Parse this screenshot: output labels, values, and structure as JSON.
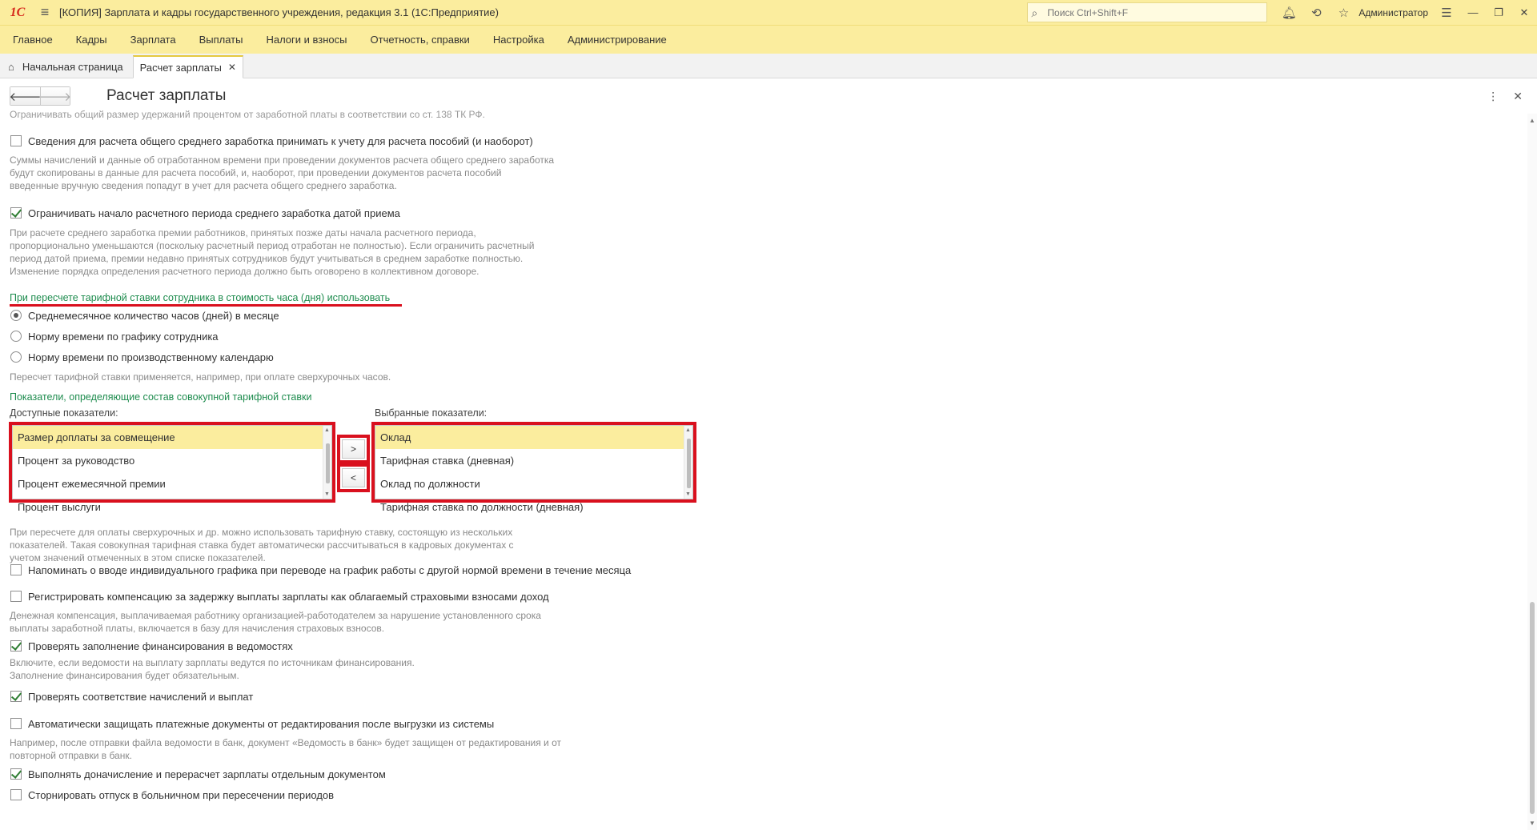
{
  "titlebar": {
    "logo": "1С",
    "title": "[КОПИЯ] Зарплата и кадры государственного учреждения, редакция 3.1  (1С:Предприятие)",
    "search_placeholder": "Поиск Ctrl+Shift+F",
    "user": "Администратор"
  },
  "menu": {
    "items": [
      "Главное",
      "Кадры",
      "Зарплата",
      "Выплаты",
      "Налоги и взносы",
      "Отчетность, справки",
      "Настройка",
      "Администрирование"
    ]
  },
  "tabs": {
    "home": "Начальная страница",
    "active": "Расчет зарплаты"
  },
  "form": {
    "title": "Расчет зарплаты"
  },
  "content": {
    "top_cut_hint": "Ограничивать общий размер удержаний процентом от заработной платы в соответствии со ст. 138 ТК РФ.",
    "cb1": {
      "label": "Сведения для расчета общего среднего заработка принимать к учету для расчета пособий (и наоборот)",
      "checked": false
    },
    "hint1": [
      "Суммы начислений и данные об отработанном времени при проведении документов расчета общего среднего заработка",
      "будут скопированы в данные для расчета пособий, и, наоборот, при проведении документов расчета пособий",
      "введенные вручную сведения попадут в учет для расчета общего среднего заработка."
    ],
    "cb2": {
      "label": "Ограничивать начало расчетного периода среднего заработка датой приема",
      "checked": true
    },
    "hint2": [
      "При расчете среднего заработка премии работников, принятых позже даты начала расчетного периода,",
      "пропорционально уменьшаются (поскольку расчетный период отработан не полностью). Если ограничить расчетный",
      "период датой приема, премии недавно принятых сотрудников будут учитываться в среднем заработке полностью.",
      "Изменение порядка определения расчетного периода должно быть оговорено в коллективном договоре."
    ],
    "group1_title": "При пересчете тарифной ставки сотрудника в стоимость часа (дня) использовать",
    "radios": [
      {
        "label": "Среднемесячное количество часов (дней) в месяце",
        "selected": true
      },
      {
        "label": "Норму времени по графику сотрудника",
        "selected": false
      },
      {
        "label": "Норму времени по производственному календарю",
        "selected": false
      }
    ],
    "hint3": "Пересчет тарифной ставки применяется, например, при оплате сверхурочных часов.",
    "group2_title": "Показатели, определяющие состав совокупной тарифной ставки",
    "available_label": "Доступные показатели:",
    "selected_label": "Выбранные показатели:",
    "available": [
      "Размер доплаты за совмещение",
      "Процент за руководство",
      "Процент ежемесячной премии",
      "Процент выслуги"
    ],
    "selected": [
      "Оклад",
      "Тарифная ставка (дневная)",
      "Оклад по должности",
      "Тарифная ставка по должности (дневная)"
    ],
    "btn_add": ">",
    "btn_remove": "<",
    "hint4": [
      "При пересчете для оплаты сверхурочных и др. можно использовать тарифную ставку, состоящую из нескольких",
      "показателей. Такая совокупная тарифная ставка будет автоматически рассчитываться в кадровых документах с",
      "учетом значений отмеченных в этом списке показателей."
    ],
    "cb3": {
      "label": "Напоминать о вводе индивидуального графика при переводе на график работы с другой нормой времени в течение месяца",
      "checked": false
    },
    "cb4": {
      "label": "Регистрировать компенсацию за задержку выплаты зарплаты как облагаемый страховыми взносами доход",
      "checked": false
    },
    "hint5": [
      "Денежная компенсация, выплачиваемая работнику организацией-работодателем за нарушение установленного срока",
      "выплаты заработной платы, включается в базу для начисления страховых взносов."
    ],
    "cb5": {
      "label": "Проверять заполнение финансирования в ведомостях",
      "checked": true
    },
    "hint6": [
      "Включите, если ведомости на выплату зарплаты ведутся по источникам финансирования.",
      "Заполнение финансирования будет обязательным."
    ],
    "cb6": {
      "label": "Проверять соответствие начислений и выплат",
      "checked": true
    },
    "cb7": {
      "label": "Автоматически защищать платежные документы от редактирования после выгрузки из системы",
      "checked": false
    },
    "hint7": [
      "Например, после отправки файла ведомости в банк, документ «Ведомость в банк» будет защищен от редактирования и от",
      "повторной отправки в банк."
    ],
    "cb8": {
      "label": "Выполнять доначисление и перерасчет зарплаты отдельным документом",
      "checked": true
    },
    "cb9": {
      "label": "Сторнировать отпуск в больничном при пересечении периодов",
      "checked": false
    }
  },
  "colors": {
    "header_bg": "#fbed9e",
    "accent_green": "#1e8c4e",
    "highlight_red": "#d9101e"
  }
}
